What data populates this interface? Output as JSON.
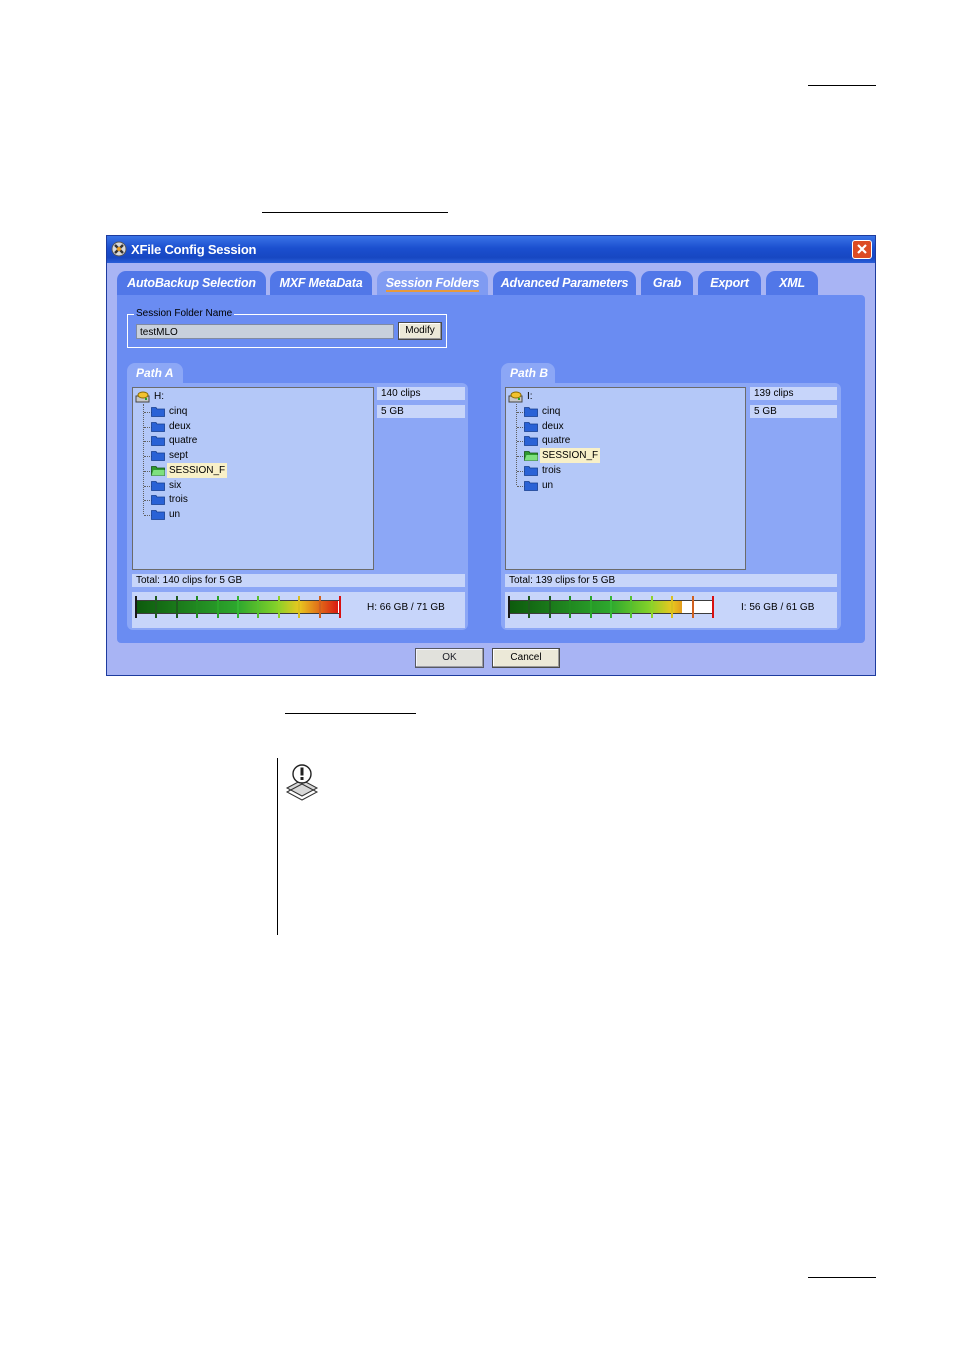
{
  "window": {
    "title": "XFile Config Session",
    "close_label": "✕"
  },
  "tabs": [
    {
      "label": "AutoBackup Selection",
      "active": false
    },
    {
      "label": "MXF MetaData",
      "active": false
    },
    {
      "label": "Session Folders",
      "active": true
    },
    {
      "label": "Advanced Parameters",
      "active": false
    },
    {
      "label": "Grab",
      "active": false
    },
    {
      "label": "Export",
      "active": false
    },
    {
      "label": "XML",
      "active": false
    }
  ],
  "session_folder": {
    "legend": "Session Folder Name",
    "value": "testMLO",
    "modify_label": "Modify"
  },
  "path_a": {
    "title": "Path A",
    "drive": "H:",
    "folders": [
      "cinq",
      "deux",
      "quatre",
      "sept",
      "SESSION_F",
      "six",
      "trois",
      "un"
    ],
    "selected": "SESSION_F",
    "clips": "140 clips",
    "size": "5 GB",
    "total": "Total: 140 clips for 5 GB",
    "disk_usage": "H: 66 GB / 71 GB",
    "fill_fraction": 0.99
  },
  "path_b": {
    "title": "Path B",
    "drive": "I:",
    "folders": [
      "cinq",
      "deux",
      "quatre",
      "SESSION_F",
      "trois",
      "un"
    ],
    "selected": "SESSION_F",
    "clips": "139 clips",
    "size": "5 GB",
    "total": "Total: 139 clips for 5 GB",
    "disk_usage": "I: 56 GB / 61 GB",
    "fill_fraction": 0.85
  },
  "buttons": {
    "ok": "OK",
    "cancel": "Cancel"
  },
  "colors": {
    "tab_active_underline": "#e89a3c",
    "gauge_low": "#0d5a0d",
    "gauge_high": "#d81010"
  }
}
